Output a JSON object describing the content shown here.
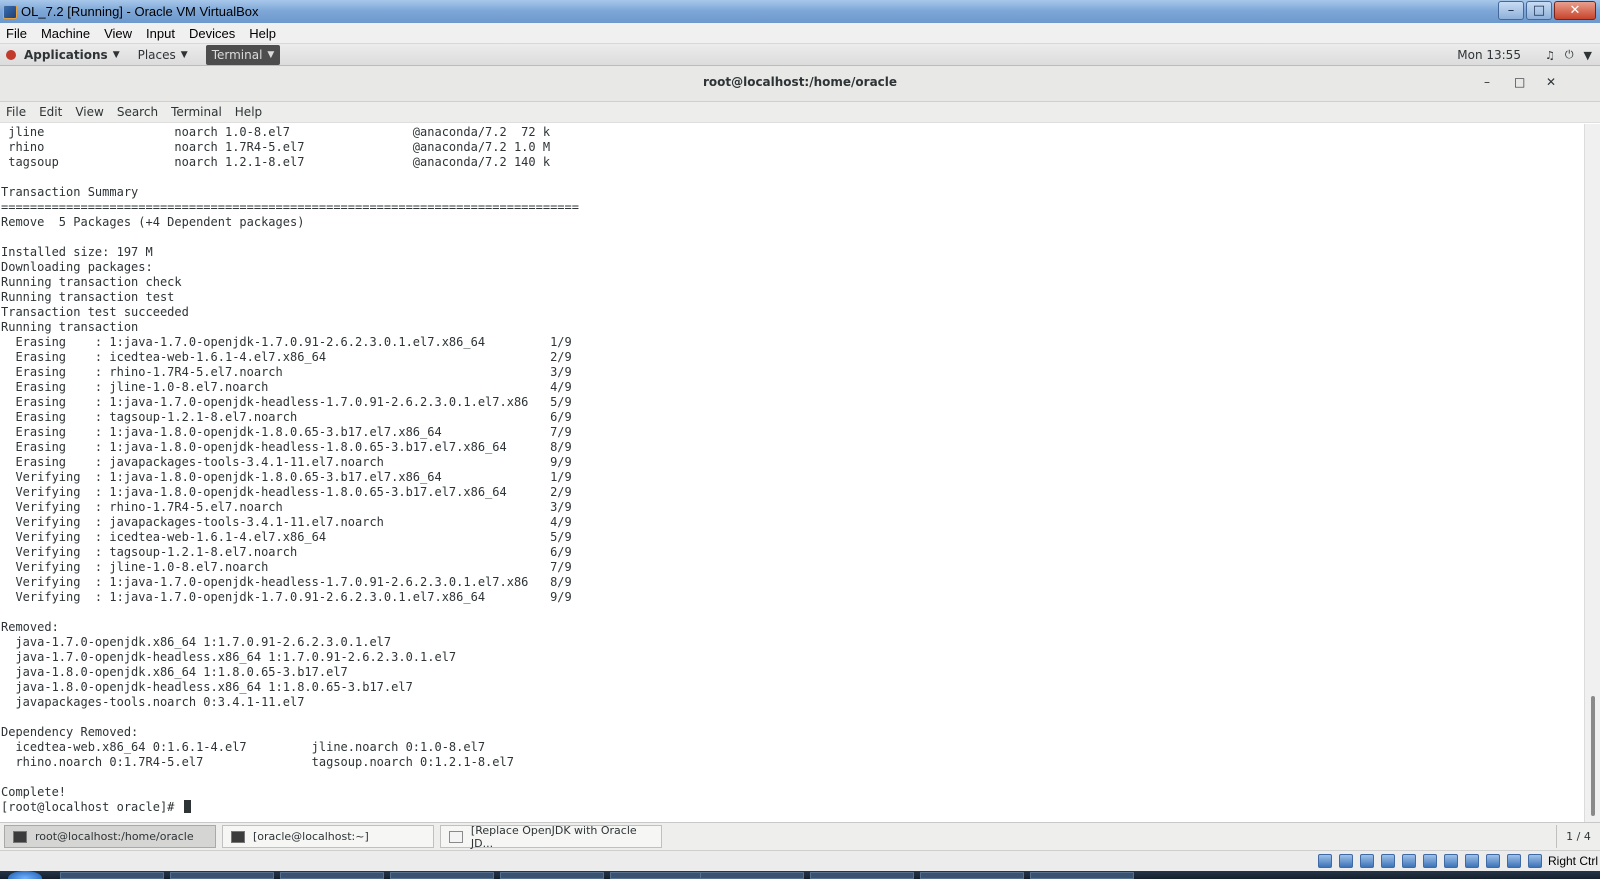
{
  "vbox": {
    "window_title": "OL_7.2 [Running] - Oracle VM VirtualBox",
    "menu": [
      "File",
      "Machine",
      "View",
      "Input",
      "Devices",
      "Help"
    ],
    "host_key": "Right Ctrl"
  },
  "gnome_panel": {
    "applications": "Applications",
    "places": "Places",
    "terminal": "Terminal",
    "clock": "Mon 13:55"
  },
  "terminal": {
    "title": "root@localhost:/home/oracle",
    "menu": [
      "File",
      "Edit",
      "View",
      "Search",
      "Terminal",
      "Help"
    ],
    "prompt": "[root@localhost oracle]# ",
    "lines": [
      " jline                  noarch 1.0-8.el7                 @anaconda/7.2  72 k",
      " rhino                  noarch 1.7R4-5.el7               @anaconda/7.2 1.0 M",
      " tagsoup                noarch 1.2.1-8.el7               @anaconda/7.2 140 k",
      "",
      "Transaction Summary",
      "================================================================================",
      "Remove  5 Packages (+4 Dependent packages)",
      "",
      "Installed size: 197 M",
      "Downloading packages:",
      "Running transaction check",
      "Running transaction test",
      "Transaction test succeeded",
      "Running transaction",
      "  Erasing    : 1:java-1.7.0-openjdk-1.7.0.91-2.6.2.3.0.1.el7.x86_64         1/9",
      "  Erasing    : icedtea-web-1.6.1-4.el7.x86_64                               2/9",
      "  Erasing    : rhino-1.7R4-5.el7.noarch                                     3/9",
      "  Erasing    : jline-1.0-8.el7.noarch                                       4/9",
      "  Erasing    : 1:java-1.7.0-openjdk-headless-1.7.0.91-2.6.2.3.0.1.el7.x86   5/9",
      "  Erasing    : tagsoup-1.2.1-8.el7.noarch                                   6/9",
      "  Erasing    : 1:java-1.8.0-openjdk-1.8.0.65-3.b17.el7.x86_64               7/9",
      "  Erasing    : 1:java-1.8.0-openjdk-headless-1.8.0.65-3.b17.el7.x86_64      8/9",
      "  Erasing    : javapackages-tools-3.4.1-11.el7.noarch                       9/9",
      "  Verifying  : 1:java-1.8.0-openjdk-1.8.0.65-3.b17.el7.x86_64               1/9",
      "  Verifying  : 1:java-1.8.0-openjdk-headless-1.8.0.65-3.b17.el7.x86_64      2/9",
      "  Verifying  : rhino-1.7R4-5.el7.noarch                                     3/9",
      "  Verifying  : javapackages-tools-3.4.1-11.el7.noarch                       4/9",
      "  Verifying  : icedtea-web-1.6.1-4.el7.x86_64                               5/9",
      "  Verifying  : tagsoup-1.2.1-8.el7.noarch                                   6/9",
      "  Verifying  : jline-1.0-8.el7.noarch                                       7/9",
      "  Verifying  : 1:java-1.7.0-openjdk-headless-1.7.0.91-2.6.2.3.0.1.el7.x86   8/9",
      "  Verifying  : 1:java-1.7.0-openjdk-1.7.0.91-2.6.2.3.0.1.el7.x86_64         9/9",
      "",
      "Removed:",
      "  java-1.7.0-openjdk.x86_64 1:1.7.0.91-2.6.2.3.0.1.el7",
      "  java-1.7.0-openjdk-headless.x86_64 1:1.7.0.91-2.6.2.3.0.1.el7",
      "  java-1.8.0-openjdk.x86_64 1:1.8.0.65-3.b17.el7",
      "  java-1.8.0-openjdk-headless.x86_64 1:1.8.0.65-3.b17.el7",
      "  javapackages-tools.noarch 0:3.4.1-11.el7",
      "",
      "Dependency Removed:",
      "  icedtea-web.x86_64 0:1.6.1-4.el7         jline.noarch 0:1.0-8.el7",
      "  rhino.noarch 0:1.7R4-5.el7               tagsoup.noarch 0:1.2.1-8.el7",
      "",
      "Complete!"
    ]
  },
  "taskbar": {
    "tasks": [
      "root@localhost:/home/oracle",
      "[oracle@localhost:~]",
      "[Replace OpenJDK with Oracle JD..."
    ],
    "pager": "1 / 4"
  }
}
